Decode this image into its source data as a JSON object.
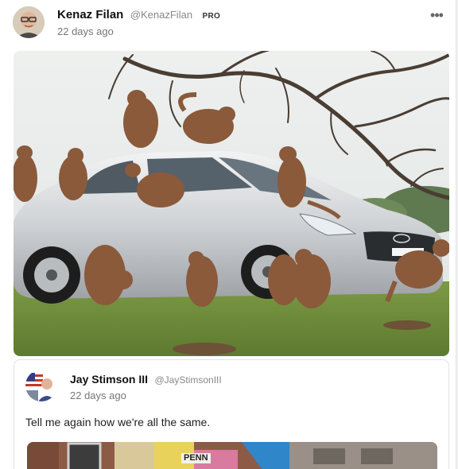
{
  "post": {
    "author_name": "Kenaz Filan",
    "author_handle": "@KenazFilan",
    "badge": "PRO",
    "timestamp": "22 days ago",
    "more_icon": "ellipsis-icon",
    "image_subject": "baboons-on-silver-car"
  },
  "quote": {
    "author_name": "Jay Stimson III",
    "author_handle": "@JayStimsonIII",
    "timestamp": "22 days ago",
    "text": "Tell me again how we're all the same.",
    "image_sign_text": "PENN"
  },
  "colors": {
    "card_bg": "#ffffff",
    "page_bg": "#f3f3f3",
    "muted_text": "#777777",
    "handle_text": "#888888"
  }
}
